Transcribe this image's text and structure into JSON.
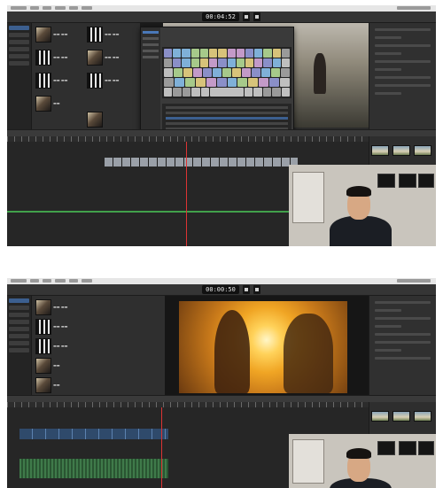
{
  "top_panel": {
    "timecode": "00:04:52"
  },
  "bottom_panel": {
    "timecode": "00:00:50"
  },
  "colors": {
    "app_bg": "#2b2b2b",
    "selection": "#3c5f8f",
    "clip_blue": "#2f4a6b",
    "clip_green": "#3f7a4a",
    "timeline_green_line": "#41a04a"
  },
  "keyboard_key_colors": [
    "#8a8fc8",
    "#7fb0d8",
    "#a6c98a",
    "#d7c37a",
    "#c39ac8",
    "#9a9a9a",
    "#bfbfbf"
  ],
  "icons": [
    "play-icon",
    "pause-icon"
  ]
}
